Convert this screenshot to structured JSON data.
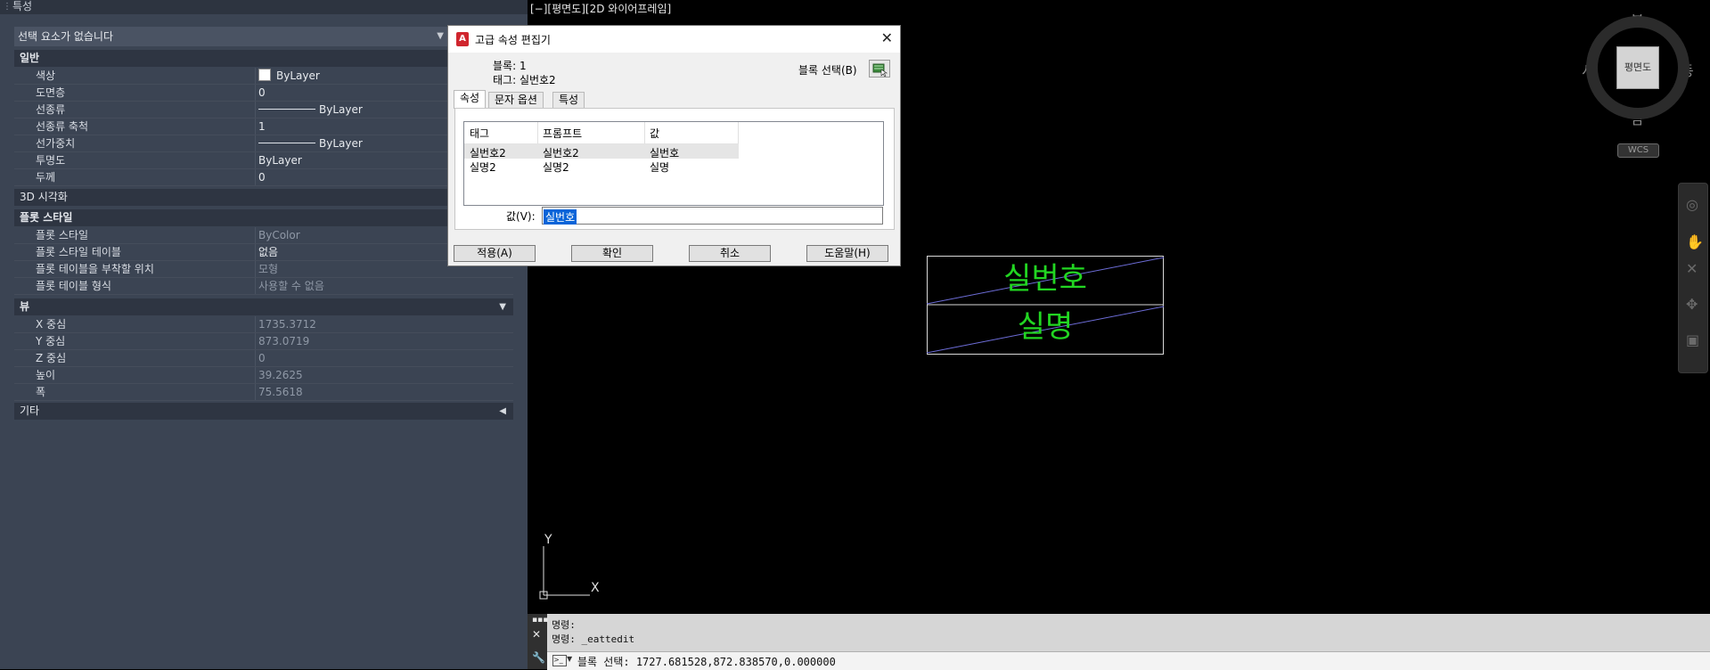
{
  "properties": {
    "title": "특성",
    "selection": "선택 요소가 없습니다",
    "sections": {
      "general": "일반",
      "visual3d": "3D 시각화",
      "plotstyle": "플롯 스타일",
      "view": "뷰",
      "misc": "기타"
    },
    "general_rows": [
      {
        "key": "색상",
        "value": "ByLayer"
      },
      {
        "key": "도면층",
        "value": "0"
      },
      {
        "key": "선종류",
        "value": "ByLayer"
      },
      {
        "key": "선종류 축척",
        "value": "1"
      },
      {
        "key": "선가중치",
        "value": "ByLayer"
      },
      {
        "key": "투명도",
        "value": "ByLayer"
      },
      {
        "key": "두께",
        "value": "0"
      }
    ],
    "plot_rows": [
      {
        "key": "플롯 스타일",
        "value": "ByColor"
      },
      {
        "key": "플롯 스타일 테이블",
        "value": "없음"
      },
      {
        "key": "플롯 테이블을 부착할 위치",
        "value": "모형"
      },
      {
        "key": "플롯 테이블 형식",
        "value": "사용할 수 없음"
      }
    ],
    "view_rows": [
      {
        "key": "X 중심",
        "value": "1735.3712"
      },
      {
        "key": "Y 중심",
        "value": "873.0719"
      },
      {
        "key": "Z 중심",
        "value": "0"
      },
      {
        "key": "높이",
        "value": "39.2625"
      },
      {
        "key": "폭",
        "value": "75.5618"
      }
    ]
  },
  "viewport": {
    "header": "[−][평면도][2D 와이어프레임]"
  },
  "dialog": {
    "title": "고급 속성 편집기",
    "block_line": "블록: 1",
    "tag_line": "태그: 실번호2",
    "block_select": "블록 선택(B)",
    "tabs": [
      "속성",
      "문자 옵션",
      "특성"
    ],
    "columns": [
      "태그",
      "프롬프트",
      "값"
    ],
    "rows": [
      [
        "실번호2",
        "실번호2",
        "실번호"
      ],
      [
        "실명2",
        "실명2",
        "실명"
      ]
    ],
    "value_label": "값(V):",
    "value": "실번호",
    "buttons": [
      "적용(A)",
      "확인",
      "취소",
      "도움말(H)"
    ]
  },
  "drawing": {
    "text_top": "실번호",
    "text_bottom": "실명",
    "text_color": "#22d622"
  },
  "viewcube": {
    "north": "북",
    "south": "남",
    "east": "동",
    "west": "서",
    "face": "평면도",
    "wcs": "WCS"
  },
  "ucs": {
    "x": "X",
    "y": "Y"
  },
  "command": {
    "history": [
      "명령:",
      "명령: _eattedit"
    ],
    "input": "블록 선택: 1727.681528,872.838570,0.000000"
  }
}
